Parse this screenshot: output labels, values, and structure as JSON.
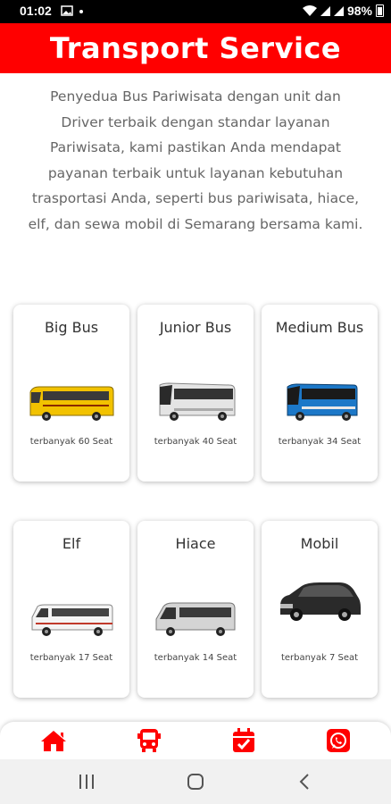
{
  "status_bar": {
    "time": "01:02",
    "battery": "98%"
  },
  "header": {
    "title": "Transport Service"
  },
  "description": "Penyedua Bus Pariwisata dengan unit dan Driver terbaik dengan standar layanan Pariwisata, kami pastikan Anda mendapat payanan terbaik untuk layanan kebutuhan trasportasi Anda, seperti bus pariwisata, hiace, elf, dan sewa mobil di Semarang bersama kami.",
  "services": [
    {
      "name": "Big Bus",
      "seats": "terbanyak 60 Seat",
      "icon": "big-bus-image",
      "color": "#f2c200"
    },
    {
      "name": "Junior Bus",
      "seats": "terbanyak 40 Seat",
      "icon": "junior-bus-image",
      "color": "#dcdcdc"
    },
    {
      "name": "Medium Bus",
      "seats": "terbanyak 34 Seat",
      "icon": "medium-bus-image",
      "color": "#1c78c8"
    },
    {
      "name": "Elf",
      "seats": "terbanyak 17 Seat",
      "icon": "elf-van-image",
      "color": "#f4f4f4"
    },
    {
      "name": "Hiace",
      "seats": "terbanyak 14 Seat",
      "icon": "hiace-van-image",
      "color": "#d4d4d4"
    },
    {
      "name": "Mobil",
      "seats": "terbanyak 7 Seat",
      "icon": "mobil-car-image",
      "color": "#2a2a2a"
    }
  ],
  "bottom_nav": [
    "home-icon",
    "bus-icon",
    "calendar-check-icon",
    "whatsapp-icon"
  ],
  "colors": {
    "brand": "#ff0000",
    "text": "#333333",
    "muted": "#666666"
  }
}
